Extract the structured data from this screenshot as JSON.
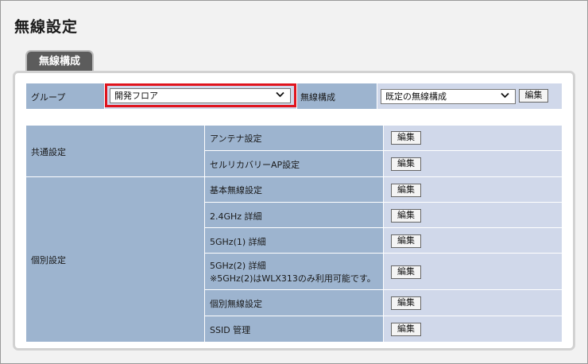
{
  "page": {
    "title": "無線設定"
  },
  "tab": {
    "label": "無線構成"
  },
  "group": {
    "label": "グループ",
    "selected": "開発フロア",
    "config_label": "無線構成",
    "config_selected": "既定の無線構成",
    "edit_label": "編集"
  },
  "table": {
    "common_label": "共通設定",
    "individual_label": "個別設定",
    "button_label": "編集",
    "rows": [
      {
        "name": "アンテナ設定"
      },
      {
        "name": "セルリカバリーAP設定"
      },
      {
        "name": "基本無線設定"
      },
      {
        "name": "2.4GHz 詳細"
      },
      {
        "name": "5GHz(1) 詳細"
      },
      {
        "name": "5GHz(2) 詳細",
        "note": "※5GHz(2)はWLX313のみ利用可能です。"
      },
      {
        "name": "個別無線設定"
      },
      {
        "name": "SSID 管理"
      }
    ]
  },
  "colors": {
    "header": "#9db4cf",
    "value": "#d0d8ea",
    "highlight": "#e0141e"
  },
  "icons": {
    "dropdown": "chevron-down-icon"
  }
}
